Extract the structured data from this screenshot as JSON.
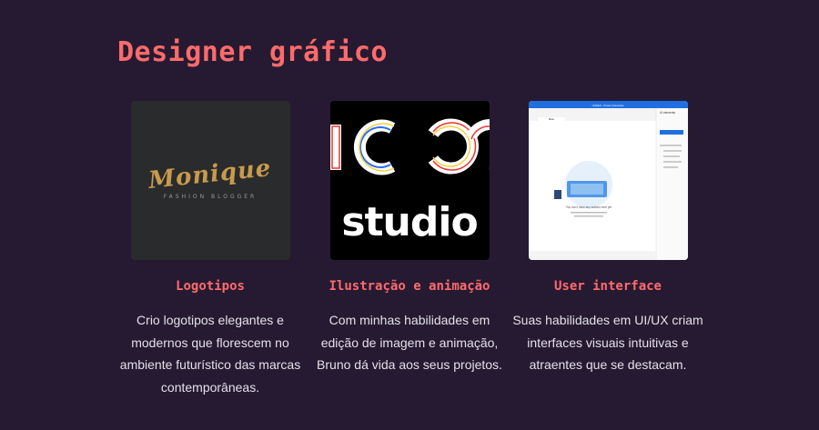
{
  "section": {
    "title": "Designer gráfico"
  },
  "cards": [
    {
      "heading": "Logotipos",
      "text": "Crio logotipos elegantes e modernos que florescem no ambiente futurístico das marcas contemporâneas.",
      "image": {
        "brand": "Monique",
        "tagline": "FASHION BLOGGER"
      }
    },
    {
      "heading": "Ilustração e animação",
      "text": "Com minhas  habilidades em edição de imagem e animação, Bruno dá vida aos seus projetos.",
      "image": {
        "wordmark": "studio"
      }
    },
    {
      "heading": "User interface",
      "text": "Suas habilidades em UI/UX criam interfaces visuais intuitivas e atraentes que se destacam.",
      "image": {
        "window_title": "Untitled - Power Automate",
        "panel_title": "UI elements",
        "tab": "Main",
        "empty_message": "You don't have any actions here yet"
      }
    }
  ],
  "colors": {
    "background": "#261a33",
    "accent": "#ff6b6b",
    "body_text": "#e4e0ea"
  }
}
